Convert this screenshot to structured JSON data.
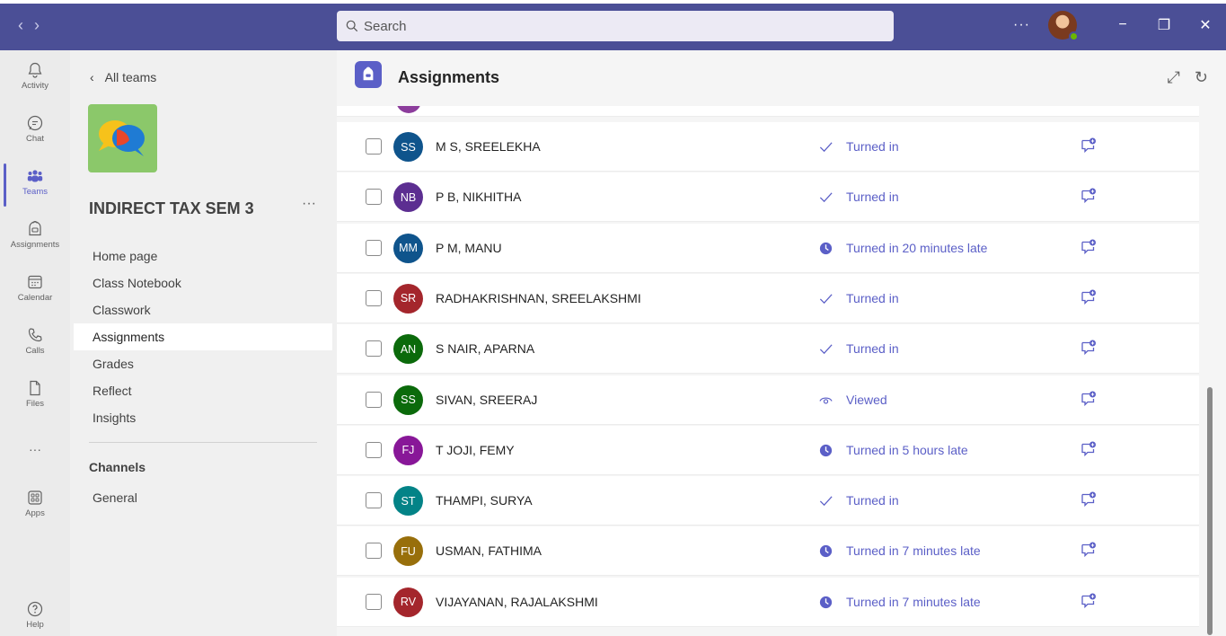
{
  "titlebar": {
    "search_placeholder": "Search",
    "more_label": "···",
    "minimize": "−",
    "maximize": "❐",
    "close": "✕",
    "back": "‹",
    "forward": "›"
  },
  "rail": {
    "items": [
      {
        "label": "Activity",
        "icon": "bell-icon"
      },
      {
        "label": "Chat",
        "icon": "chat-icon"
      },
      {
        "label": "Teams",
        "icon": "teams-icon"
      },
      {
        "label": "Assignments",
        "icon": "assignments-icon"
      },
      {
        "label": "Calendar",
        "icon": "calendar-icon"
      },
      {
        "label": "Calls",
        "icon": "phone-icon"
      },
      {
        "label": "Files",
        "icon": "file-icon"
      },
      {
        "label": "···",
        "icon": "more-icon"
      },
      {
        "label": "Apps",
        "icon": "apps-icon"
      },
      {
        "label": "Help",
        "icon": "help-icon"
      }
    ],
    "active": "Teams"
  },
  "teampane": {
    "all_teams": "All teams",
    "team_name": "INDIRECT TAX SEM 3",
    "more": "···",
    "menu": [
      "Home page",
      "Class Notebook",
      "Classwork",
      "Assignments",
      "Grades",
      "Reflect",
      "Insights"
    ],
    "selected": "Assignments",
    "channels_title": "Channels",
    "channels": [
      "General"
    ]
  },
  "main": {
    "title": "Assignments",
    "students": [
      {
        "initials": "SS",
        "name": "M S, SREELEKHA",
        "status": "Turned in",
        "status_icon": "check-icon",
        "color": "#0f548c"
      },
      {
        "initials": "NB",
        "name": "P B, NIKHITHA",
        "status": "Turned in",
        "status_icon": "check-icon",
        "color": "#5c2e91"
      },
      {
        "initials": "MM",
        "name": "P M, MANU",
        "status": "Turned in 20 minutes late",
        "status_icon": "clock-icon",
        "color": "#0f548c"
      },
      {
        "initials": "SR",
        "name": "RADHAKRISHNAN, SREELAKSHMI",
        "status": "Turned in",
        "status_icon": "check-icon",
        "color": "#a4262c"
      },
      {
        "initials": "AN",
        "name": "S NAIR, APARNA",
        "status": "Turned in",
        "status_icon": "check-icon",
        "color": "#0b6a0b"
      },
      {
        "initials": "SS",
        "name": "SIVAN, SREERAJ",
        "status": "Viewed",
        "status_icon": "eye-icon",
        "color": "#0b6a0b"
      },
      {
        "initials": "FJ",
        "name": "T JOJI, FEMY",
        "status": "Turned in 5 hours late",
        "status_icon": "clock-icon",
        "color": "#881798"
      },
      {
        "initials": "ST",
        "name": "THAMPI, SURYA",
        "status": "Turned in",
        "status_icon": "check-icon",
        "color": "#038387"
      },
      {
        "initials": "FU",
        "name": "USMAN, FATHIMA",
        "status": "Turned in 7 minutes late",
        "status_icon": "clock-icon",
        "color": "#986f0b"
      },
      {
        "initials": "RV",
        "name": "VIJAYANAN, RAJALAKSHMI",
        "status": "Turned in 7 minutes late",
        "status_icon": "clock-icon",
        "color": "#a4262c"
      }
    ]
  },
  "colors": {
    "titlebar": "#4b4f96",
    "accent": "#5b5fc7"
  }
}
